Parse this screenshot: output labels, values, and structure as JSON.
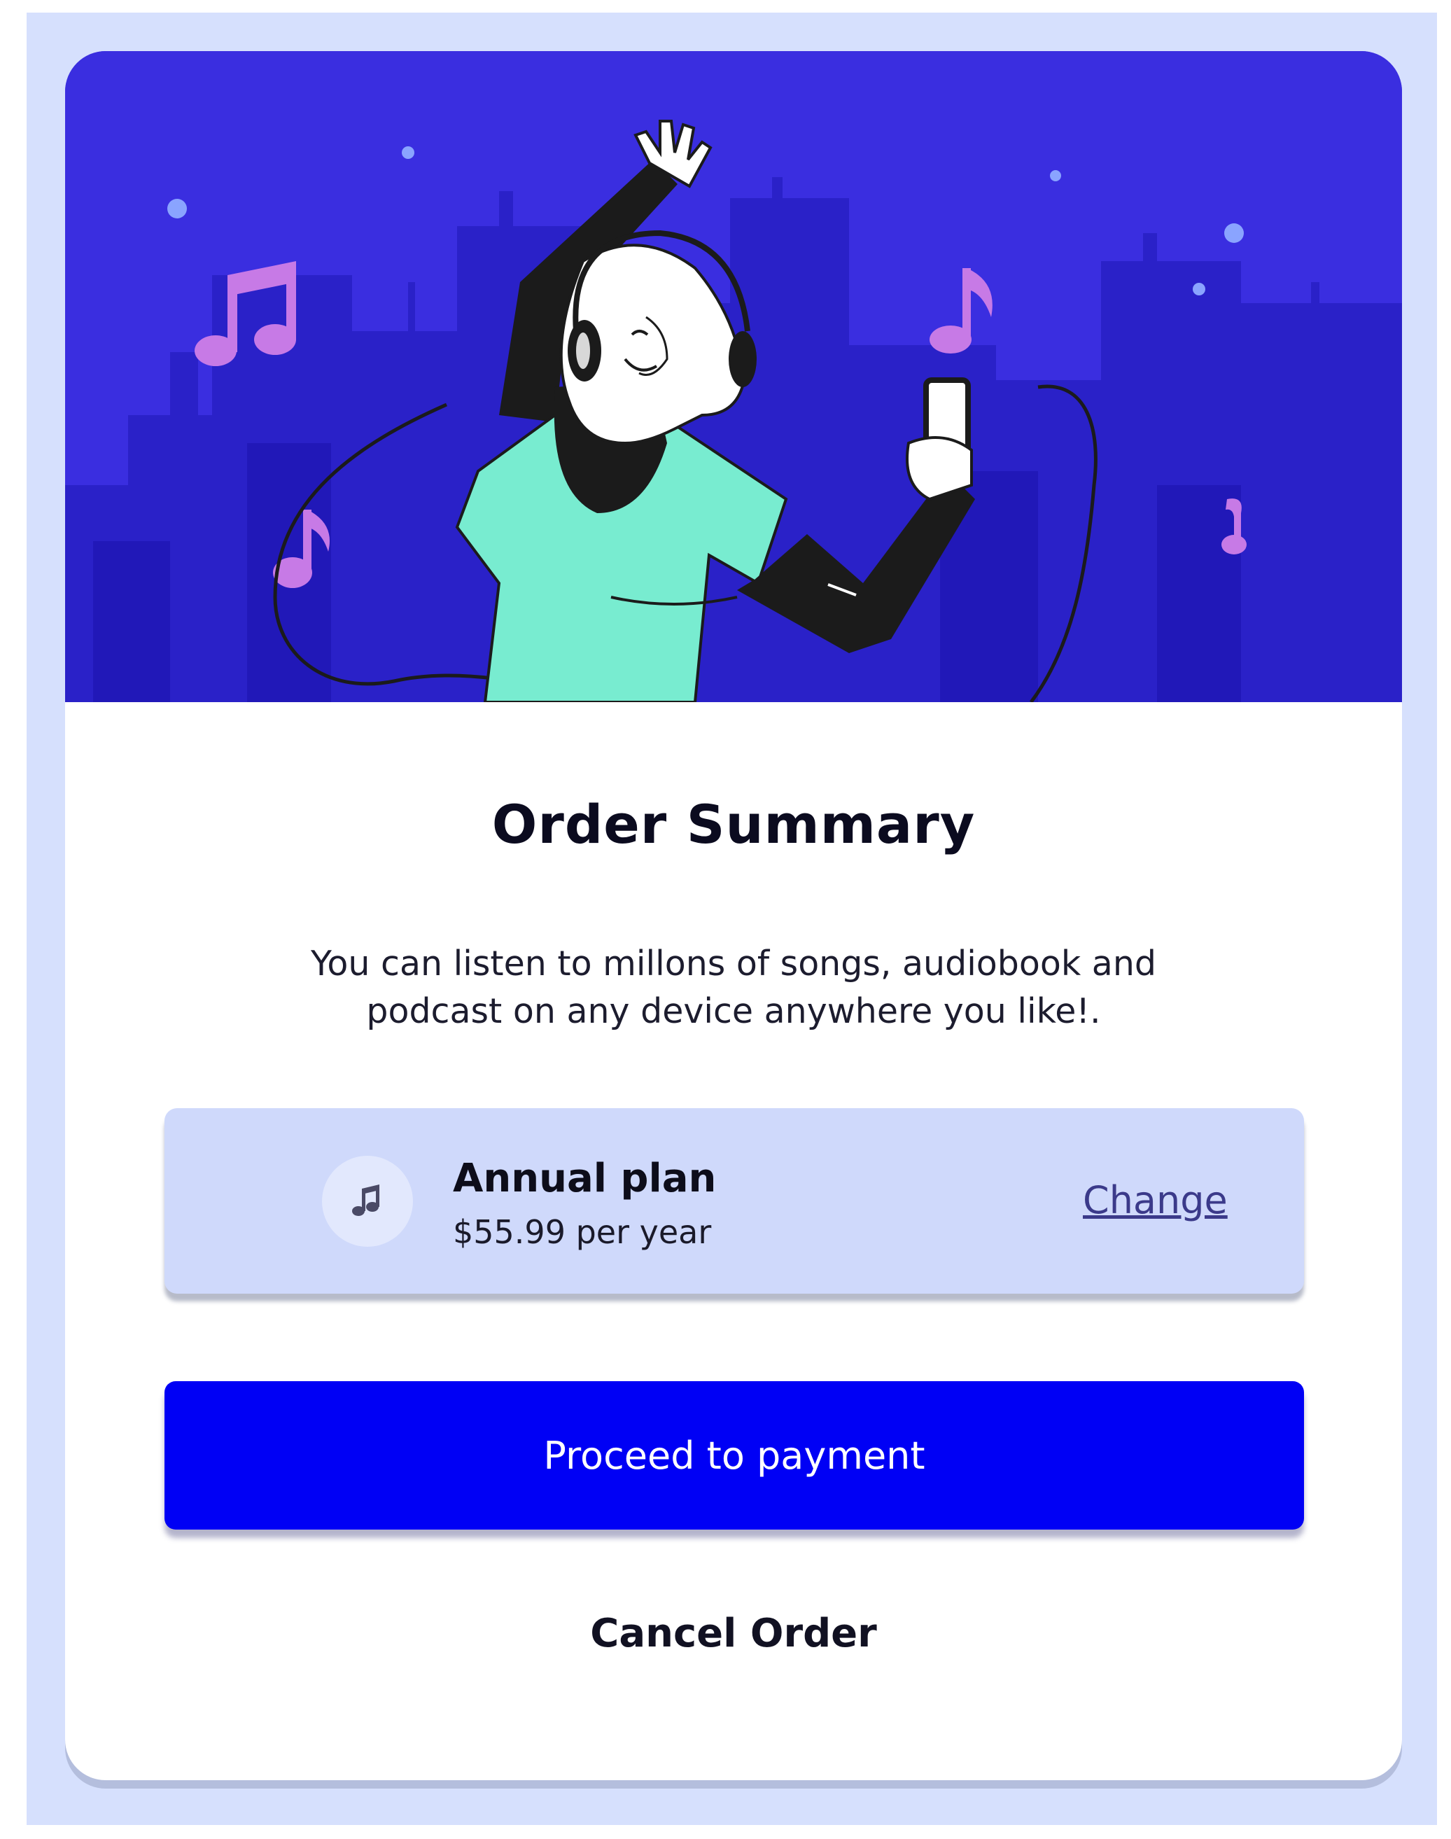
{
  "order": {
    "title": "Order Summary",
    "description": "You can listen to millons of songs, audiobook and podcast on any device anywhere you like!.",
    "plan": {
      "icon": "music-note-icon",
      "name": "Annual plan",
      "price": "$55.99 per year",
      "change_label": "Change"
    },
    "proceed_label": "Proceed to payment",
    "cancel_label": "Cancel Order"
  },
  "colors": {
    "page_background": "#d6e0fd",
    "hero_background": "#3a2ee0",
    "plan_box": "#cfd9fb",
    "primary_button": "#0000f5",
    "music_note": "#c77ae6",
    "shirt": "#78ecd0"
  }
}
